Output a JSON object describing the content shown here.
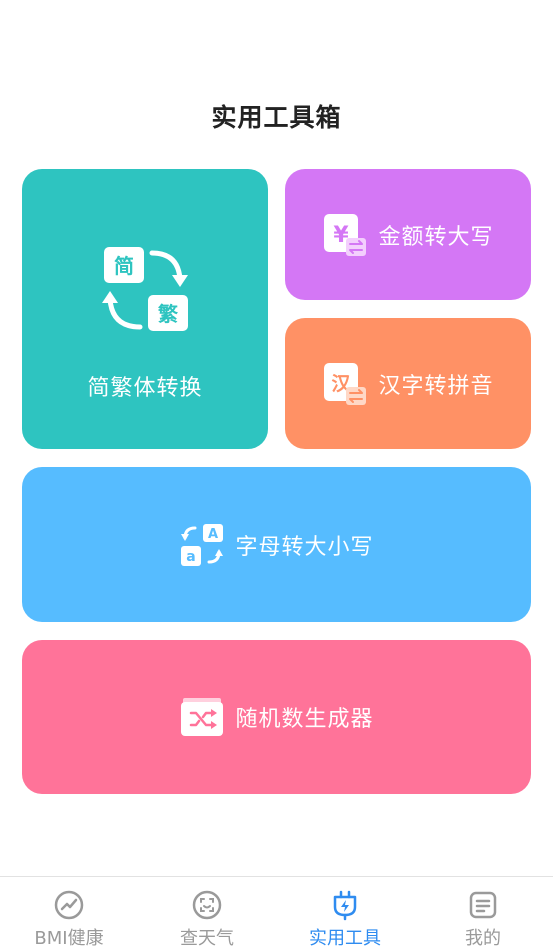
{
  "header": {
    "title": "实用工具箱"
  },
  "colors": {
    "teal": "#2ec4c0",
    "purple": "#d477f5",
    "orange": "#ff9165",
    "blue": "#56bcff",
    "pink": "#ff7399",
    "tab_active": "#2f8cf0",
    "tab_inactive": "#9a9a9a"
  },
  "cards": {
    "simptrad": {
      "label": "简繁体转换",
      "badge_simplified": "简",
      "badge_traditional": "繁",
      "icon": "simplified-traditional-convert-icon"
    },
    "money": {
      "label": "金额转大写",
      "icon_text": "¥",
      "icon": "currency-convert-icon"
    },
    "pinyin": {
      "label": "汉字转拼音",
      "icon_text": "汉",
      "icon": "hanzi-convert-icon"
    },
    "case": {
      "label": "字母转大小写",
      "icon_upper": "A",
      "icon_lower": "a",
      "icon": "letter-case-icon"
    },
    "random": {
      "label": "随机数生成器",
      "icon": "shuffle-icon"
    }
  },
  "tabs": [
    {
      "label": "BMI健康",
      "icon": "health-chart-icon",
      "active": false
    },
    {
      "label": "查天气",
      "icon": "weather-face-icon",
      "active": false
    },
    {
      "label": "实用工具",
      "icon": "plug-bolt-icon",
      "active": true
    },
    {
      "label": "我的",
      "icon": "profile-card-icon",
      "active": false
    }
  ]
}
